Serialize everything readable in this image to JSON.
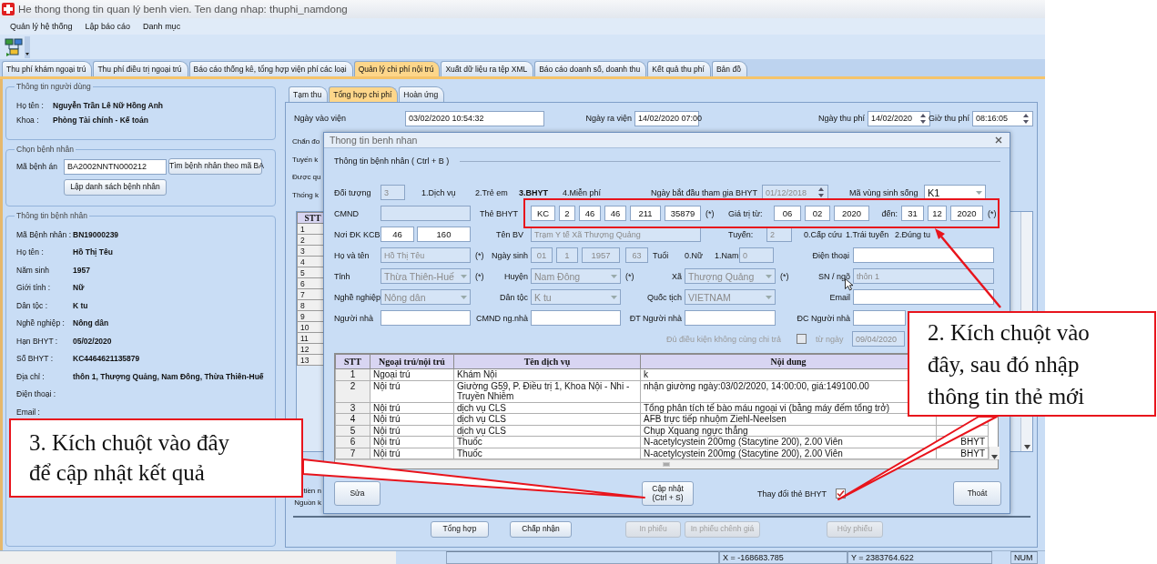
{
  "window": {
    "title": "He thong thong tin quan lý benh vien. Ten dang nhap: thuphi_namdong"
  },
  "menu": [
    "Quản lý hệ thống",
    "Lập báo cáo",
    "Danh mục"
  ],
  "tabs": [
    {
      "label": "Thu phí khám ngoại trú",
      "selected": false
    },
    {
      "label": "Thu phí điều trị ngoại trú",
      "selected": false
    },
    {
      "label": "Báo cáo thống kê, tổng hợp viện phí các loại",
      "selected": false
    },
    {
      "label": "Quản lý chi phí nội trú",
      "selected": true
    },
    {
      "label": "Xuất dữ liệu ra tệp XML",
      "selected": false
    },
    {
      "label": "Báo cáo doanh số, doanh thu",
      "selected": false
    },
    {
      "label": "Kết quả thu phí",
      "selected": false
    },
    {
      "label": "Bản đồ",
      "selected": false
    }
  ],
  "user_info": {
    "title": "Thông tin người dùng",
    "fields": [
      {
        "label": "Họ tên :",
        "value": "Nguyễn Trần Lê Nữ Hồng Anh"
      },
      {
        "label": "Khoa :",
        "value": "Phòng Tài chính - Kế toán"
      }
    ]
  },
  "patient_select": {
    "title": "Chọn bệnh nhân",
    "label": "Mã bệnh án",
    "value": "BA2002NNTN000212",
    "search_button": "Tìm bệnh nhân theo mã BA",
    "list_button": "Lập danh sách bệnh nhân"
  },
  "patient_info": {
    "title": "Thông tin bệnh nhân",
    "fields": [
      {
        "label": "Mã Bệnh nhân :",
        "value": "BN19000239"
      },
      {
        "label": "Họ tên :",
        "value": "Hồ Thị Têu"
      },
      {
        "label": "Năm sinh",
        "value": "1957"
      },
      {
        "label": "Giới tính :",
        "value": "Nữ"
      },
      {
        "label": "Dân tộc :",
        "value": "K tu"
      },
      {
        "label": "Nghề nghiệp :",
        "value": "Nông dân"
      },
      {
        "label": "Hạn BHYT :",
        "value": "05/02/2020"
      },
      {
        "label": "Số BHYT :",
        "value": "KC4464621135879"
      },
      {
        "label": "Địa chỉ :",
        "value": "thôn 1, Thượng Quảng, Nam Đông, Thừa Thiên-Huế"
      },
      {
        "label": "Điện thoại :"
      },
      {
        "label": "Email :"
      }
    ]
  },
  "costs": {
    "subtabs": [
      {
        "label": "Tạm thu",
        "selected": false
      },
      {
        "label": "Tổng hợp chi phí",
        "selected": true
      },
      {
        "label": "Hoàn ứng",
        "selected": false
      }
    ],
    "header_fields": [
      {
        "label": "Ngày vào viện",
        "value": "03/02/2020 10:54:32",
        "kind": "text"
      },
      {
        "label": "Ngày ra viện",
        "value": "14/02/2020 07:00",
        "kind": "text"
      },
      {
        "label": "Ngày thu phí",
        "value": "14/02/2020",
        "kind": "spin"
      },
      {
        "label": "Giờ thu phí",
        "value": "08:16:05",
        "kind": "spin"
      }
    ],
    "side_labels": [
      "Chẩn đo",
      "Tuyến k",
      "Được qu",
      "Thống k"
    ],
    "grid": {
      "header": "STT",
      "rows": [
        "1",
        "2",
        "3",
        "4",
        "5",
        "6",
        "7",
        "8",
        "9",
        "10",
        "11",
        "12",
        "13"
      ]
    },
    "lower_labels": [
      "tiền n",
      "Nguồn k"
    ],
    "buttons": [
      {
        "label": "Tổng hợp",
        "disabled": false
      },
      {
        "label": "Chấp nhận",
        "disabled": false
      },
      {
        "label": "In phiếu",
        "disabled": true
      },
      {
        "label": "In phiếu chênh giá",
        "disabled": true
      },
      {
        "label": "Hủy phiếu",
        "disabled": true
      }
    ]
  },
  "dialog": {
    "title": "Thong tin benh nhan",
    "section": "Thông tin bệnh nhân ( Ctrl + B )",
    "subject": {
      "label": "Đối tượng",
      "value": "3",
      "options": [
        {
          "label": "1.Dịch vụ",
          "selected": false
        },
        {
          "label": "2.Trẻ em",
          "selected": false
        },
        {
          "label": "3.BHYT",
          "selected": true
        },
        {
          "label": "4.Miễn phí",
          "selected": false
        }
      ]
    },
    "bhyt_start": {
      "label": "Ngày bắt đầu tham gia BHYT",
      "value": "01/12/2018",
      "disabled": true
    },
    "region": {
      "label": "Mã vùng sinh sống",
      "value": "K1"
    },
    "id_card": {
      "label": "CMND"
    },
    "card": {
      "label": "Thẻ BHYT",
      "parts": [
        "KC",
        "2",
        "46",
        "46",
        "211",
        "35879"
      ],
      "required": "(*)"
    },
    "valid_from": {
      "label": "Giá trị từ:",
      "parts": [
        "06",
        "02",
        "2020"
      ]
    },
    "valid_to": {
      "label": "đến:",
      "parts": [
        "31",
        "12",
        "2020"
      ],
      "required": "(*)"
    },
    "register": {
      "label": "Nơi ĐK KCB",
      "parts": [
        "46",
        "160"
      ]
    },
    "hospital": {
      "label": "Tên BV",
      "value": "Trạm Y tế Xã Thượng Quảng",
      "disabled": true
    },
    "route": {
      "label": "Tuyến:",
      "value": "2",
      "disabled": true,
      "options": [
        "0.Cấp cứu",
        "1.Trái tuyến",
        "2.Đúng tu"
      ]
    },
    "name": {
      "label": "Họ và tên",
      "value": "Hồ Thị Têu",
      "disabled": true,
      "required": "(*)"
    },
    "birth": {
      "label": "Ngày sinh",
      "parts": [
        "01",
        "1",
        "1957"
      ],
      "disabled": true
    },
    "age": {
      "value": "63",
      "label": "Tuổi",
      "disabled": true
    },
    "gender": {
      "options": [
        "0.Nữ",
        "1.Nam"
      ],
      "value": "0",
      "disabled": true
    },
    "phone": {
      "label": "Điện thoại"
    },
    "rows": [
      [
        {
          "label": "Tỉnh",
          "kind": "combo",
          "value": "Thừa Thiên-Huế",
          "disabled": true,
          "required": "(*)"
        },
        {
          "label": "Huyện",
          "kind": "combo",
          "value": "Nam Đông",
          "disabled": true,
          "required": "(*)"
        },
        {
          "label": "Xã",
          "kind": "combo",
          "value": "Thượng Quảng",
          "disabled": true,
          "required": "(*)"
        },
        {
          "label": "SN / ngõ",
          "kind": "text",
          "value": "thôn 1",
          "disabled": true
        }
      ],
      [
        {
          "label": "Nghề nghiệp",
          "kind": "combo",
          "value": "Nông dân",
          "disabled": true
        },
        {
          "label": "Dân tộc",
          "kind": "combo",
          "value": "K tu",
          "disabled": true
        },
        {
          "label": "Quốc tịch",
          "kind": "combo",
          "value": "VIETNAM",
          "disabled": true
        },
        {
          "label": "Email",
          "kind": "text"
        }
      ],
      [
        {
          "label": "Người nhà",
          "kind": "text"
        },
        {
          "label": "CMND ng.nhà",
          "kind": "text"
        },
        {
          "label": "ĐT Người nhà",
          "kind": "text"
        },
        {
          "label": "ĐC Người nhà",
          "kind": "text"
        }
      ]
    ],
    "copay": {
      "label": "Đủ điều kiện không cùng chi trả",
      "checked": false,
      "from_label": "từ ngày",
      "from_value": "09/04/2020",
      "disabled": true
    },
    "table": {
      "columns": [
        "STT",
        "Ngoại trú/nội trú",
        "Tên dịch vụ",
        "Nội dung"
      ],
      "rows": [
        {
          "stt": "1",
          "type": "Ngoại trú",
          "service": "Khám Nội",
          "content": "k"
        },
        {
          "stt": "2",
          "type": "Nội trú",
          "service": "Giường G59, P. Điều trị 1, Khoa Nội - Nhi - Truyền Nhiễm",
          "content": "nhận giường ngày:03/02/2020, 14:00:00, giá:149100.00"
        },
        {
          "stt": "3",
          "type": "Nội trú",
          "service": "dịch vụ CLS",
          "content": "Tổng phân tích tế bào máu ngoại vi (bằng máy đếm tổng trở)"
        },
        {
          "stt": "4",
          "type": "Nội trú",
          "service": "dịch vụ CLS",
          "content": "AFB trực tiếp nhuộm Ziehl-Neelsen"
        },
        {
          "stt": "5",
          "type": "Nội trú",
          "service": "dịch vụ CLS",
          "content": "Chụp Xquang ngực thẳng"
        },
        {
          "stt": "6",
          "type": "Nội trú",
          "service": "Thuốc",
          "content": "N-acetylcystein 200mg (Stacytine 200), 2.00 Viên",
          "column_5": "BHYT"
        },
        {
          "stt": "7",
          "type": "Nội trú",
          "service": "Thuốc",
          "content": "N-acetylcystein 200mg (Stacytine 200), 2.00 Viên",
          "column_5": "BHYT"
        }
      ]
    },
    "edit_button": "Sửa",
    "update_button": [
      "Cập nhật",
      "(Ctrl + S)"
    ],
    "change_card": {
      "label": "Thay đổi thẻ BHYT",
      "checked": true
    },
    "exit_button": "Thoát"
  },
  "status_bar": [
    "X = -168683.785",
    "Y = 2383764.622",
    "NUM"
  ],
  "callouts": [
    {
      "lines": [
        "2. Kích chuột vào",
        "đây, sau đó nhập",
        "thông tin thẻ mới"
      ]
    },
    {
      "lines": [
        "3. Kích chuột vào đây",
        "để cập nhật kết quả"
      ]
    }
  ]
}
